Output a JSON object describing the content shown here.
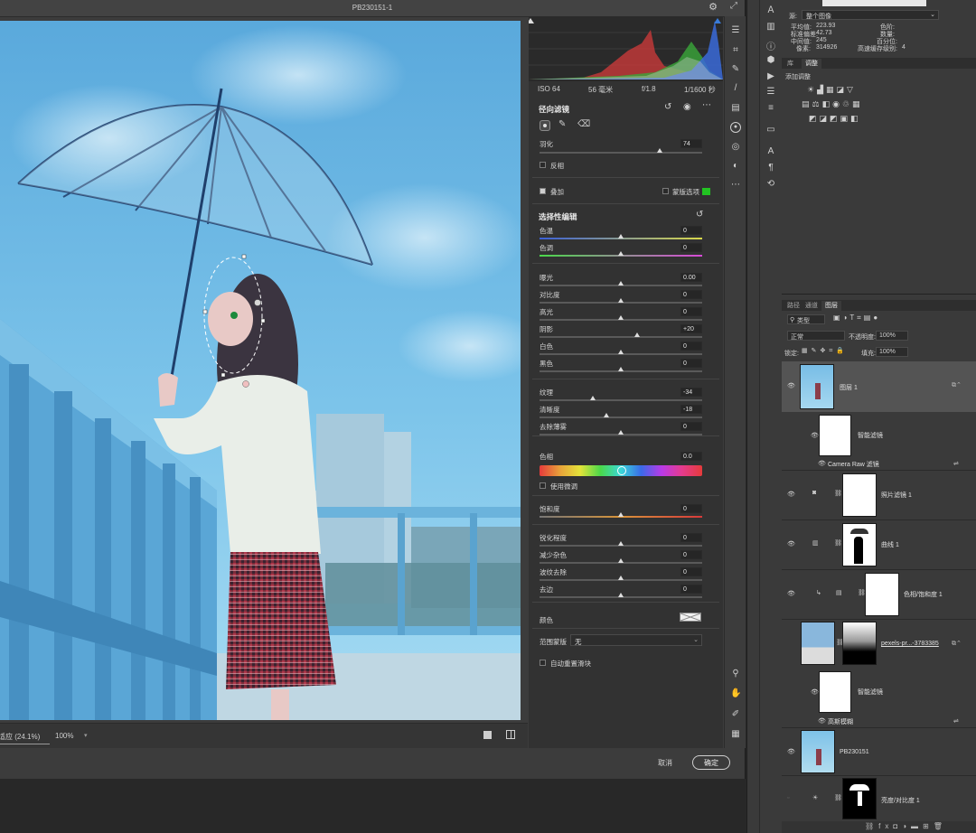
{
  "dialog": {
    "title": "PB230151-1",
    "zoom_label": "适应 (24.1%)",
    "zoom_value": "100%",
    "cancel": "取消",
    "ok": "确定"
  },
  "exif": {
    "iso": "ISO 64",
    "focal": "56 毫米",
    "aperture": "f/1.8",
    "shutter": "1/1600 秒"
  },
  "radial": {
    "title": "径向滤镜",
    "feather_label": "羽化",
    "feather_value": "74",
    "feather_pct": 0.74,
    "invert_label": "反相",
    "overlay_label": "叠加",
    "mask_option_label": "蒙版选项",
    "mask_color": "#22c322"
  },
  "selective": {
    "title": "选择性编辑",
    "groups": [
      [
        {
          "label": "色温",
          "value": "0",
          "pos": 0.5,
          "track": "temp"
        },
        {
          "label": "色调",
          "value": "0",
          "pos": 0.5,
          "track": "tint"
        }
      ],
      [
        {
          "label": "曝光",
          "value": "0.00",
          "pos": 0.5
        },
        {
          "label": "对比度",
          "value": "0",
          "pos": 0.5
        },
        {
          "label": "高光",
          "value": "0",
          "pos": 0.5
        },
        {
          "label": "阴影",
          "value": "+20",
          "pos": 0.6
        },
        {
          "label": "白色",
          "value": "0",
          "pos": 0.5
        },
        {
          "label": "黑色",
          "value": "0",
          "pos": 0.5
        }
      ],
      [
        {
          "label": "纹理",
          "value": "-34",
          "pos": 0.33
        },
        {
          "label": "清晰度",
          "value": "-18",
          "pos": 0.41
        },
        {
          "label": "去除薄雾",
          "value": "0",
          "pos": 0.5
        }
      ]
    ],
    "hue_label": "色相",
    "hue_value": "0.0",
    "fine_adjust_label": "使用微调",
    "saturation": {
      "label": "饱和度",
      "value": "0",
      "pos": 0.5
    },
    "detail": [
      {
        "label": "锐化程度",
        "value": "0",
        "pos": 0.5
      },
      {
        "label": "减少杂色",
        "value": "0",
        "pos": 0.5
      },
      {
        "label": "波纹去除",
        "value": "0",
        "pos": 0.5
      },
      {
        "label": "去边",
        "value": "0",
        "pos": 0.5
      }
    ],
    "color_label": "颜色",
    "range_mask_label": "范围蒙版",
    "range_mask_value": "无",
    "auto_mask_label": "自动重置滑块"
  },
  "ps_info": {
    "source_label": "源:",
    "source_value": "整个图像",
    "mean_label": "平均值:",
    "mean_value": "223.93",
    "std_label": "标准偏差:",
    "std_value": "42.73",
    "median_label": "中间值:",
    "median_value": "245",
    "pixels_label": "像素:",
    "pixels_value": "314926",
    "level_label": "色阶:",
    "count_label": "数量:",
    "pct_label": "百分位:",
    "cache_label": "高速缓存级别:",
    "cache_value": "4"
  },
  "adj_panel": {
    "tab_lib": "库",
    "tab_adj": "调整",
    "add_label": "添加调整"
  },
  "layers_panel": {
    "tabs": [
      "路径",
      "通道",
      "图层"
    ],
    "kind": "类型",
    "blend": "正常",
    "opacity_label": "不透明度:",
    "opacity": "100%",
    "lock_label": "锁定:",
    "fill_label": "填充:",
    "fill": "100%",
    "layers": [
      {
        "name": "图层 1"
      },
      {
        "name": "智能滤镜"
      },
      {
        "name": "Camera Raw 滤镜"
      },
      {
        "name": "照片滤镜 1"
      },
      {
        "name": "曲线 1"
      },
      {
        "name": "色相/饱和度 1"
      },
      {
        "name": "pexels-pr...-3783385"
      },
      {
        "name": "智能滤镜"
      },
      {
        "name": "高斯模糊"
      },
      {
        "name": "PB230151"
      },
      {
        "name": "亮度/对比度 1"
      }
    ]
  }
}
